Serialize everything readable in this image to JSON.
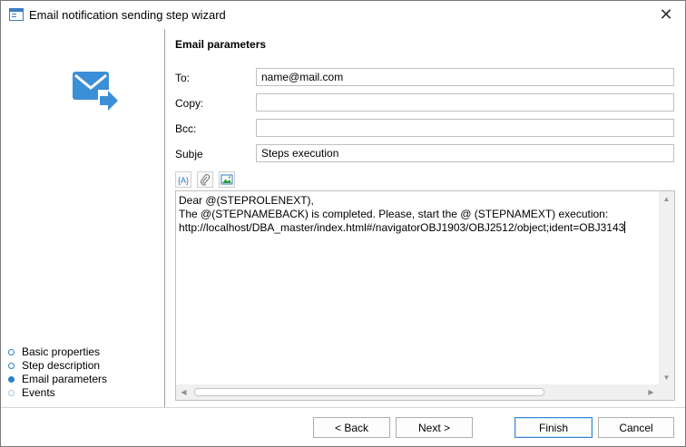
{
  "window": {
    "title": "Email notification sending step wizard"
  },
  "sidebar": {
    "steps": [
      {
        "label": "Basic properties",
        "state": "done"
      },
      {
        "label": "Step description",
        "state": "done"
      },
      {
        "label": "Email parameters",
        "state": "active"
      },
      {
        "label": "Events",
        "state": "disabled"
      }
    ]
  },
  "form": {
    "section_title": "Email parameters",
    "to": {
      "label": "To:",
      "value": "name@mail.com"
    },
    "copy": {
      "label": "Copy:",
      "value": ""
    },
    "bcc": {
      "label": "Bcc:",
      "value": ""
    },
    "subject": {
      "label": "Subject:",
      "value": "Steps execution"
    }
  },
  "toolbar": {
    "variable_label": "{A}"
  },
  "editor": {
    "lines": [
      "Dear @(STEPROLENEXT),",
      "The @(STEPNAMEBACK) is completed. Please, start the @ (STEPNAMEXT) execution:",
      "http://localhost/DBA_master/index.html#/navigatorOBJ1903/OBJ2512/object;ident=OBJ3143"
    ]
  },
  "buttons": {
    "back": "< Back",
    "next": "Next >",
    "finish": "Finish",
    "cancel": "Cancel"
  },
  "colors": {
    "accent": "#2d7fc4",
    "icon_blue": "#3b8fd6"
  }
}
